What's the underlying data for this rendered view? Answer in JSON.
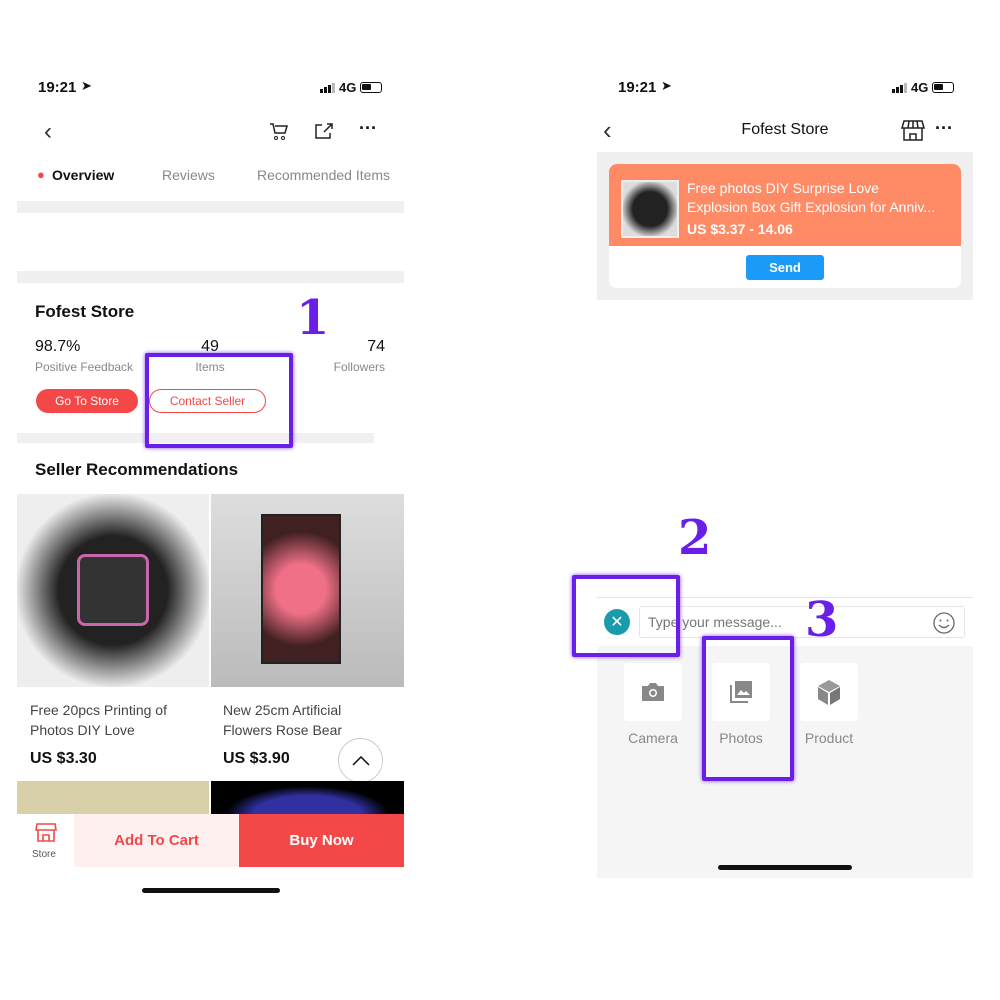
{
  "left": {
    "status": {
      "time": "19:21",
      "network": "4G"
    },
    "tabs": [
      {
        "label": "Overview",
        "active": true
      },
      {
        "label": "Reviews"
      },
      {
        "label": "Recommended Items"
      }
    ],
    "store": {
      "name": "Fofest Store",
      "stats": [
        {
          "value": "98.7%",
          "label": "Positive Feedback"
        },
        {
          "value": "49",
          "label": "Items"
        },
        {
          "value": "74",
          "label": "Followers"
        }
      ],
      "go_to_store": "Go To Store",
      "contact_seller": "Contact Seller"
    },
    "recommendations": {
      "title": "Seller Recommendations",
      "items": [
        {
          "title_line1": "Free 20pcs Printing of",
          "title_line2": "Photos DIY Love",
          "price": "US $3.30"
        },
        {
          "title_line1": "New 25cm Artificial",
          "title_line2": "Flowers Rose Bear",
          "price": "US $3.90"
        }
      ]
    },
    "bottom_bar": {
      "store": "Store",
      "add_to_cart": "Add To Cart",
      "buy_now": "Buy Now"
    }
  },
  "right": {
    "status": {
      "time": "19:21",
      "network": "4G"
    },
    "header_title": "Fofest Store",
    "product_card": {
      "title_line1": "Free photos DIY Surprise Love",
      "title_line2": "Explosion Box Gift Explosion for Anniv...",
      "price": "US $3.37 - 14.06",
      "send": "Send"
    },
    "message_placeholder": "Type your message...",
    "attach": [
      {
        "label": "Camera",
        "icon": "camera-icon"
      },
      {
        "label": "Photos",
        "icon": "photos-icon"
      },
      {
        "label": "Product",
        "icon": "cube-icon"
      }
    ]
  },
  "annotations": [
    "1",
    "2",
    "3"
  ],
  "colors": {
    "accent": "#f44848",
    "annotation": "#6a1fe8",
    "send": "#1a9bf7",
    "card": "#ff8a66",
    "close": "#1a9aaa"
  }
}
